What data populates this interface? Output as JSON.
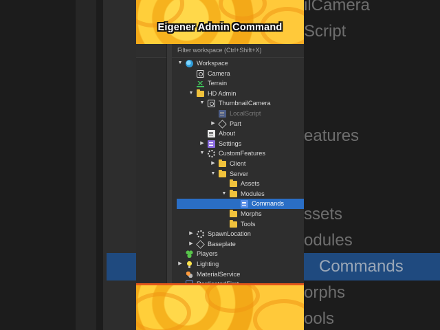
{
  "video": {
    "title": "Eigener Admin Command"
  },
  "explorer": {
    "filter_placeholder": "Filter workspace (Ctrl+Shift+X)",
    "items": [
      {
        "label": "Workspace",
        "icon": "globe-icon",
        "depth": 0,
        "expander": "expanded"
      },
      {
        "label": "Camera",
        "icon": "camera-icon",
        "depth": 1,
        "expander": "none"
      },
      {
        "label": "Terrain",
        "icon": "terrain-icon",
        "depth": 1,
        "expander": "none"
      },
      {
        "label": "HD Admin",
        "icon": "folder-icon",
        "depth": 1,
        "expander": "expanded"
      },
      {
        "label": "ThumbnailCamera",
        "icon": "camera-icon",
        "depth": 2,
        "expander": "expanded"
      },
      {
        "label": "LocalScript",
        "icon": "localscript-icon",
        "depth": 3,
        "expander": "none",
        "disabled": true
      },
      {
        "label": "Part",
        "icon": "part-icon",
        "depth": 3,
        "expander": "collapsed"
      },
      {
        "label": "About",
        "icon": "document-icon",
        "depth": 2,
        "expander": "none"
      },
      {
        "label": "Settings",
        "icon": "settings-script-icon",
        "depth": 2,
        "expander": "collapsed"
      },
      {
        "label": "CustomFeatures",
        "icon": "gear-icon",
        "depth": 2,
        "expander": "expanded"
      },
      {
        "label": "Client",
        "icon": "folder-icon",
        "depth": 3,
        "expander": "collapsed"
      },
      {
        "label": "Server",
        "icon": "folder-icon",
        "depth": 3,
        "expander": "expanded"
      },
      {
        "label": "Assets",
        "icon": "folder-icon",
        "depth": 4,
        "expander": "none"
      },
      {
        "label": "Modules",
        "icon": "folder-icon",
        "depth": 4,
        "expander": "expanded"
      },
      {
        "label": "Commands",
        "icon": "modulescript-icon",
        "depth": 5,
        "expander": "none",
        "selected": true
      },
      {
        "label": "Morphs",
        "icon": "folder-icon",
        "depth": 4,
        "expander": "none"
      },
      {
        "label": "Tools",
        "icon": "folder-icon",
        "depth": 4,
        "expander": "none"
      },
      {
        "label": "SpawnLocation",
        "icon": "gear-icon",
        "depth": 1,
        "expander": "collapsed"
      },
      {
        "label": "Baseplate",
        "icon": "part-icon",
        "depth": 1,
        "expander": "collapsed"
      },
      {
        "label": "Players",
        "icon": "players-icon",
        "depth": 0,
        "expander": "none"
      },
      {
        "label": "Lighting",
        "icon": "lightbulb-icon",
        "depth": 0,
        "expander": "collapsed"
      },
      {
        "label": "MaterialService",
        "icon": "material-icon",
        "depth": 0,
        "expander": "none"
      },
      {
        "label": "ReplicatedFirst",
        "icon": "storage-icon",
        "depth": 0,
        "expander": "none"
      }
    ]
  },
  "background_zoom": {
    "right_labels": [
      "ilCamera",
      "Script",
      "eatures",
      "ssets",
      "odules",
      "Commands",
      "orphs",
      "ools"
    ]
  },
  "colors": {
    "selection": "#2a6ec5",
    "panel": "#2e2e2e",
    "banner_yellow": "#f6b21e",
    "banner_edge": "#e2561a"
  }
}
